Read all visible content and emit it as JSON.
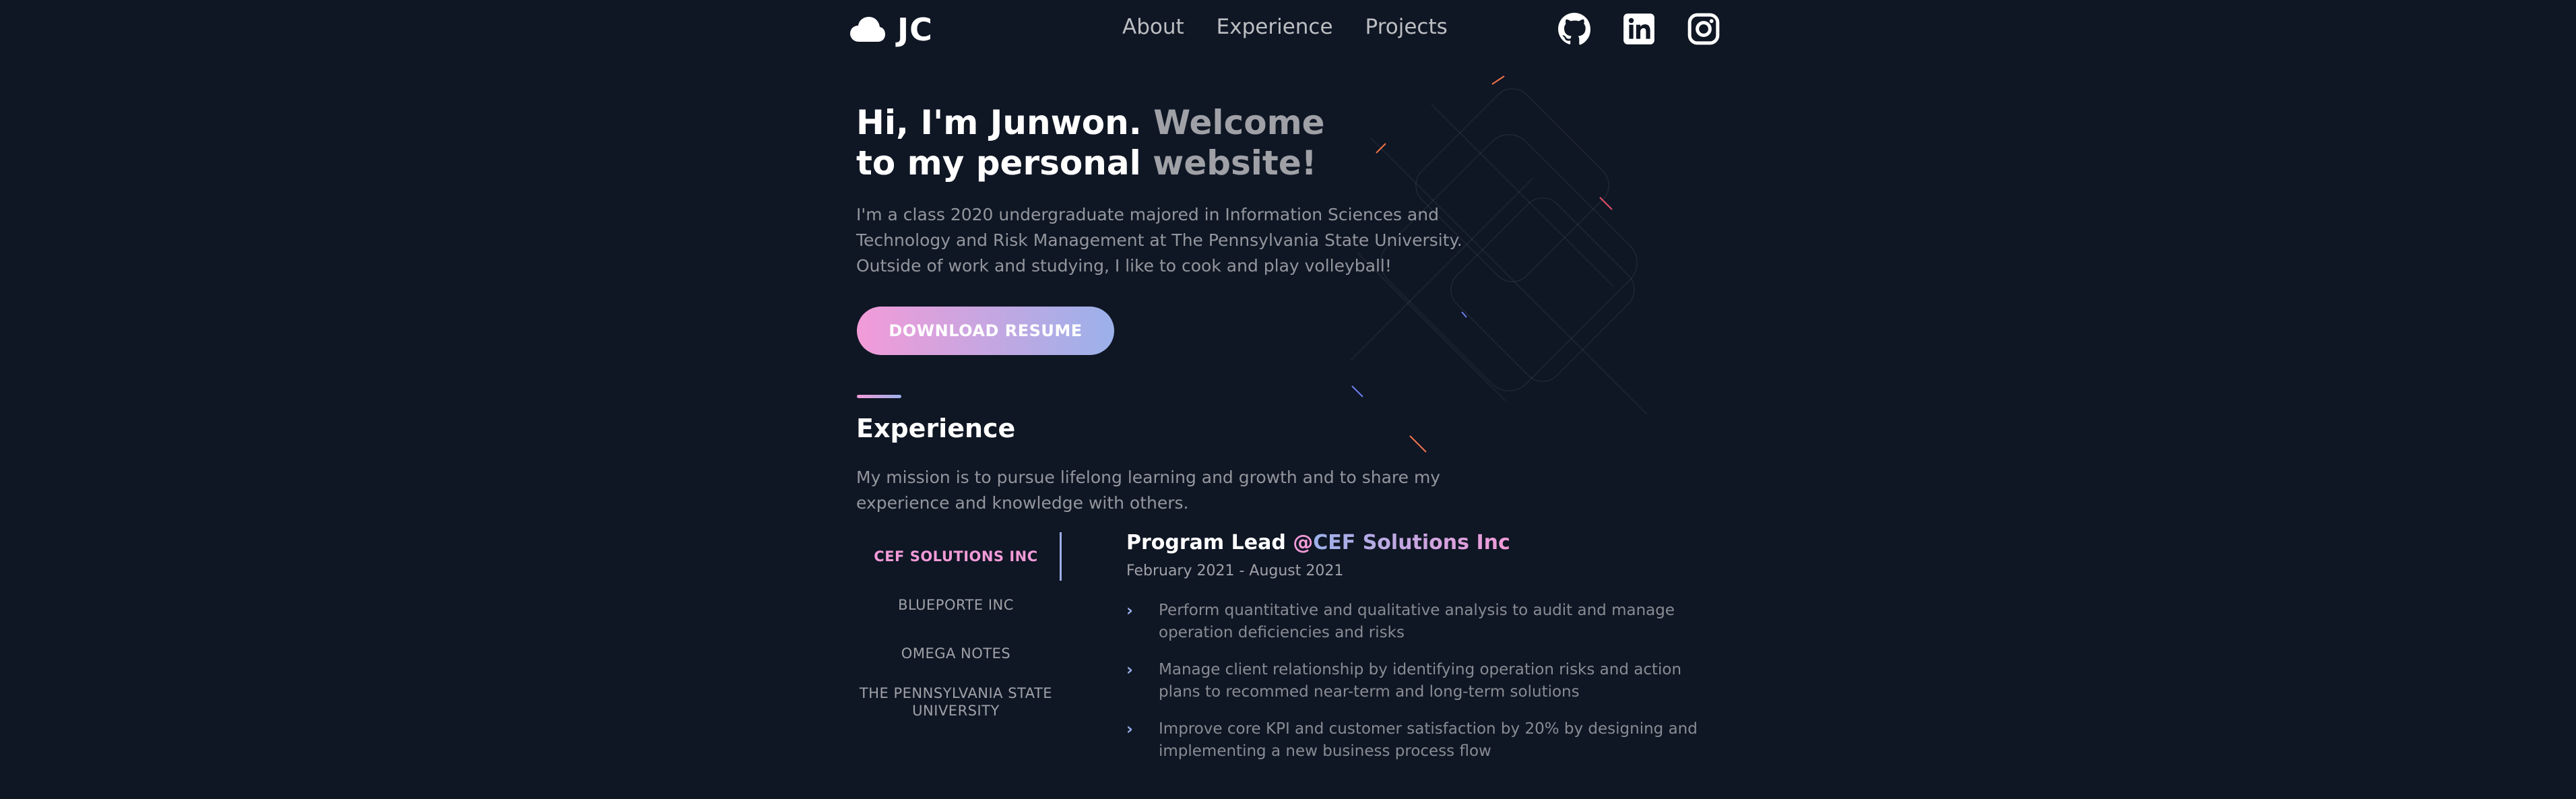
{
  "brand": {
    "logo_text": "JC",
    "logo_icon": "cloud-icon"
  },
  "nav": {
    "items": [
      {
        "label": "About"
      },
      {
        "label": "Experience"
      },
      {
        "label": "Projects"
      }
    ]
  },
  "social": {
    "icons": [
      "github-icon",
      "linkedin-icon",
      "instagram-icon"
    ]
  },
  "hero": {
    "title_white": "Hi, I'm Junwon.",
    "title_muted_1": "Welcome",
    "title_line2_white": "to my personal",
    "title_line2_muted": "website!",
    "description": "I'm a class 2020 undergraduate majored in Information Sciences and Technology and Risk Management at The Pennsylvania State University. Outside of work and studying, I like to cook and play volleyball!",
    "button_label": "DOWNLOAD RESUME"
  },
  "experience": {
    "title": "Experience",
    "description": "My mission is to pursue lifelong learning and growth and to share my experience and knowledge with others.",
    "tabs": [
      {
        "label": "CEF Solutions Inc",
        "active": true
      },
      {
        "label": "Blueporte Inc",
        "active": false
      },
      {
        "label": "Omega Notes",
        "active": false
      },
      {
        "label": "The Pennsylvania State University",
        "active": false
      }
    ],
    "job": {
      "role": "Program Lead",
      "at": "@",
      "company": "CEF Solutions Inc",
      "dates": "February 2021 - August 2021",
      "bullets": [
        "Perform quantitative and qualitative analysis to audit and manage operation deficiencies and risks",
        "Manage client relationship by identifying operation risks and action plans to recommed near-term and long-term solutions",
        "Improve core KPI and customer satisfaction by 20% by designing and implementing a new business process flow"
      ]
    }
  },
  "colors": {
    "background": "#0f1624",
    "accent_pink": "#f29bd8",
    "accent_blue": "#9bb1ea"
  }
}
